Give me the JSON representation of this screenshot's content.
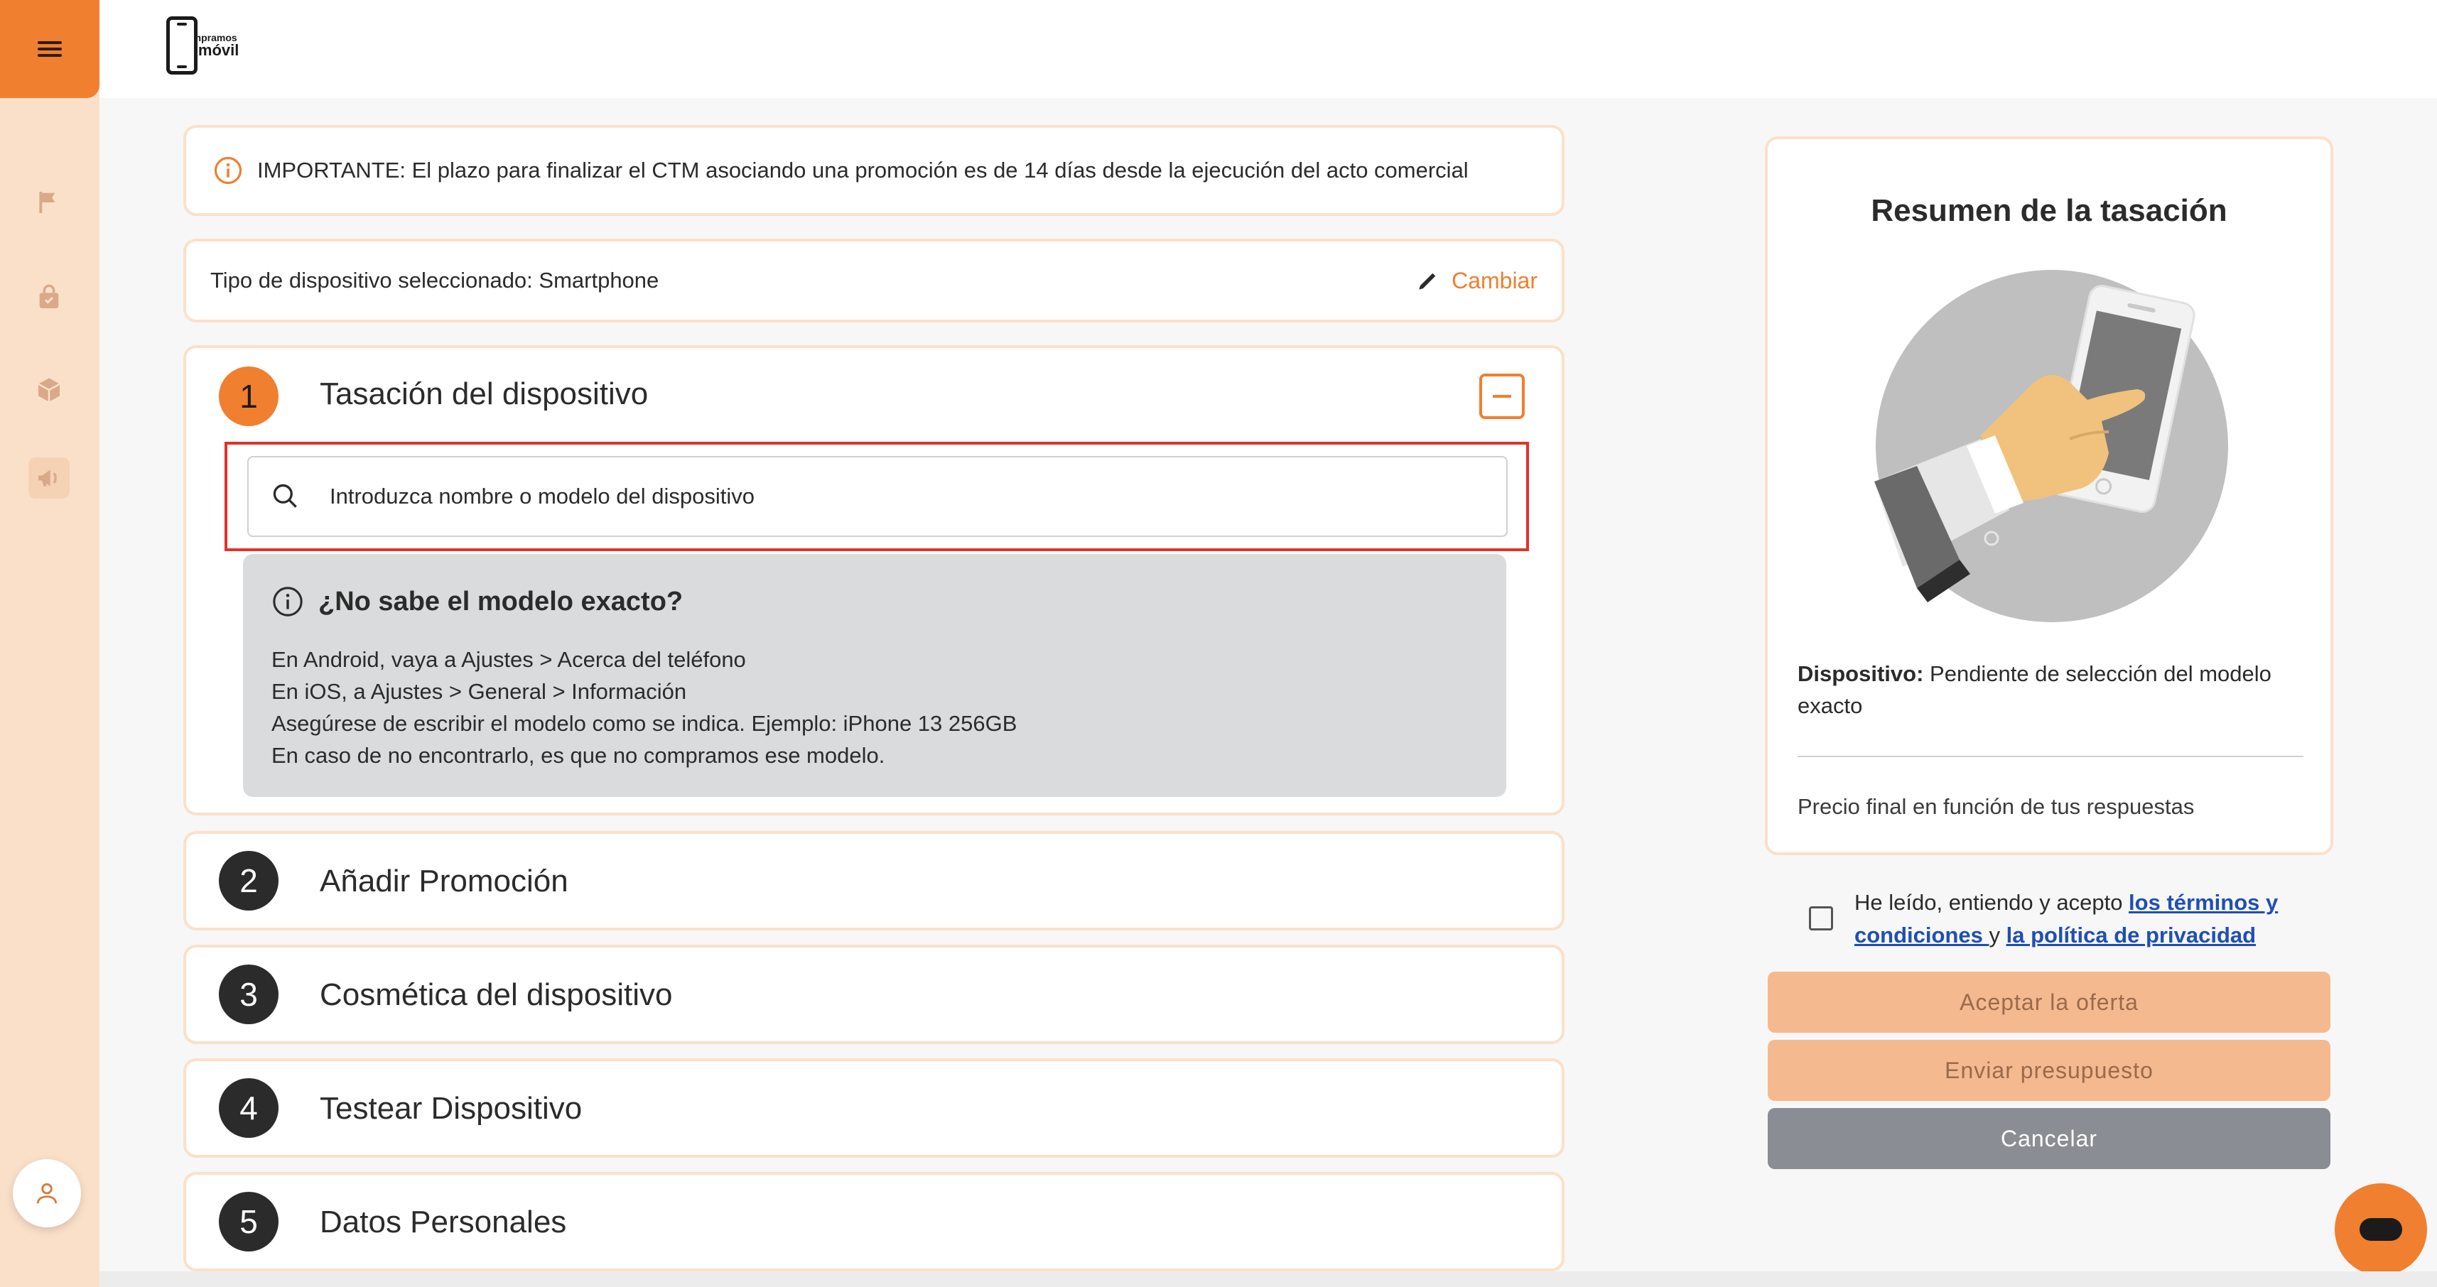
{
  "header": {
    "logo_line1": "Compramos",
    "logo_line2": "tu móvil"
  },
  "sidebar": {
    "items": [
      {
        "icon": "flag-icon"
      },
      {
        "icon": "shopping-bag-icon"
      },
      {
        "icon": "box-icon"
      },
      {
        "icon": "megaphone-icon"
      }
    ]
  },
  "notice": {
    "text": "IMPORTANTE: El plazo para finalizar el CTM asociando una promoción es de 14 días desde la ejecución del acto comercial"
  },
  "device_type": {
    "text": "Tipo de dispositivo seleccionado: Smartphone",
    "change_label": "Cambiar"
  },
  "steps": [
    {
      "number": "1",
      "title": "Tasación del dispositivo"
    },
    {
      "number": "2",
      "title": "Añadir Promoción"
    },
    {
      "number": "3",
      "title": "Cosmética del dispositivo"
    },
    {
      "number": "4",
      "title": "Testear Dispositivo"
    },
    {
      "number": "5",
      "title": "Datos Personales"
    }
  ],
  "search": {
    "placeholder": "Introduzca nombre o modelo del dispositivo",
    "value": ""
  },
  "help": {
    "title": "¿No sabe el modelo exacto?",
    "lines": [
      "En Android, vaya a Ajustes > Acerca del teléfono",
      "En iOS, a Ajustes > General > Información",
      "Asegúrese de escribir el modelo como se indica. Ejemplo: iPhone 13 256GB",
      "En caso de no encontrarlo, es que no compramos ese modelo."
    ]
  },
  "summary": {
    "title": "Resumen de la tasación",
    "device_label": "Dispositivo:",
    "device_value": "Pendiente de selección del modelo exacto",
    "price_text": "Precio final en función de tus respuestas"
  },
  "terms": {
    "text_before": "He leído, entiendo y acepto ",
    "link_terms": "los términos y condiciones ",
    "text_mid": "y ",
    "link_privacy": "la política de privacidad",
    "checked": false
  },
  "buttons": {
    "accept": "Aceptar la oferta",
    "budget": "Enviar presupuesto",
    "cancel": "Cancelar"
  },
  "colors": {
    "accent": "#f07f2f",
    "sidebar_bg": "#fbe0c9",
    "highlight_border": "#e0332a",
    "link": "#1f4fb3"
  }
}
